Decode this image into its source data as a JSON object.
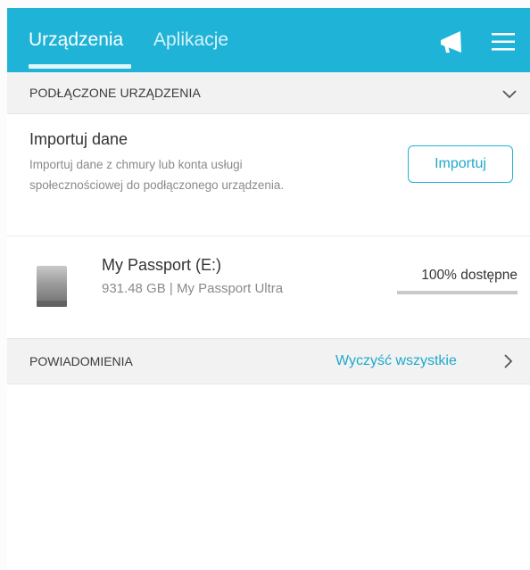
{
  "header": {
    "tabs": [
      {
        "label": "Urządzenia",
        "active": true
      },
      {
        "label": "Aplikacje",
        "active": false
      }
    ],
    "icons": [
      "megaphone-icon",
      "hamburger-menu-icon"
    ]
  },
  "connected": {
    "section_label": "PODŁĄCZONE URZĄDZENIA",
    "import": {
      "title": "Importuj dane",
      "description": "Importuj dane z chmury lub konta usługi społecznościowej do podłączonego urządzenia.",
      "button_label": "Importuj"
    },
    "device": {
      "name": "My Passport (E:)",
      "meta": "931.48 GB | My Passport Ultra",
      "availability": "100% dostępne",
      "available_fraction": 1.0
    }
  },
  "notifications": {
    "section_label": "POWIADOMIENIA",
    "clear_label": "Wyczyść wszystkie"
  },
  "colors": {
    "accent": "#1fb3d8",
    "link": "#1fa9cc",
    "section_bg": "#f2f2f2"
  }
}
